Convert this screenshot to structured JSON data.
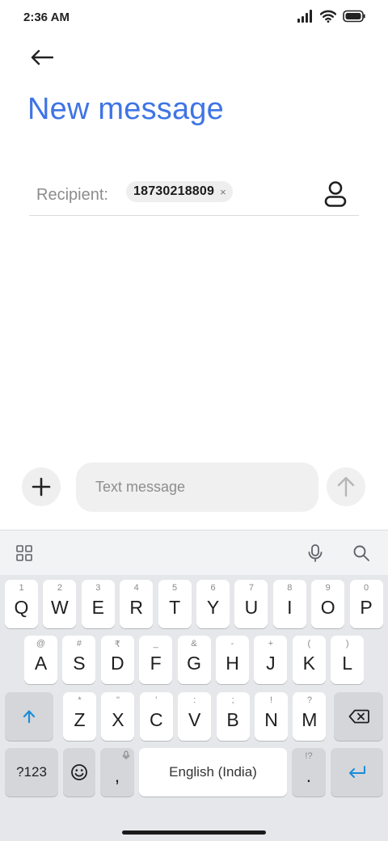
{
  "status_bar": {
    "time": "2:36 AM"
  },
  "header": {
    "title": "New message"
  },
  "recipient": {
    "label": "Recipient:",
    "chip_number": "18730218809",
    "chip_remove": "×"
  },
  "compose": {
    "placeholder": "Text message"
  },
  "keyboard": {
    "row1": [
      {
        "hint": "1",
        "key": "Q"
      },
      {
        "hint": "2",
        "key": "W"
      },
      {
        "hint": "3",
        "key": "E"
      },
      {
        "hint": "4",
        "key": "R"
      },
      {
        "hint": "5",
        "key": "T"
      },
      {
        "hint": "6",
        "key": "Y"
      },
      {
        "hint": "7",
        "key": "U"
      },
      {
        "hint": "8",
        "key": "I"
      },
      {
        "hint": "9",
        "key": "O"
      },
      {
        "hint": "0",
        "key": "P"
      }
    ],
    "row2": [
      {
        "hint": "@",
        "key": "A"
      },
      {
        "hint": "#",
        "key": "S"
      },
      {
        "hint": "₹",
        "key": "D"
      },
      {
        "hint": "_",
        "key": "F"
      },
      {
        "hint": "&",
        "key": "G"
      },
      {
        "hint": "-",
        "key": "H"
      },
      {
        "hint": "+",
        "key": "J"
      },
      {
        "hint": "(",
        "key": "K"
      },
      {
        "hint": ")",
        "key": "L"
      }
    ],
    "row3": [
      {
        "hint": "*",
        "key": "Z"
      },
      {
        "hint": "\"",
        "key": "X"
      },
      {
        "hint": "'",
        "key": "C"
      },
      {
        "hint": ":",
        "key": "V"
      },
      {
        "hint": ";",
        "key": "B"
      },
      {
        "hint": "!",
        "key": "N"
      },
      {
        "hint": "?",
        "key": "M"
      }
    ],
    "symbols_label": "?123",
    "comma": ",",
    "space_label": "English (India)",
    "period": ".",
    "period_hint": "!?",
    "icons": {
      "shift": "shift-icon",
      "backspace": "backspace-icon",
      "emoji": "emoji-icon",
      "enter": "enter-icon",
      "mic": "mic-icon",
      "search": "search-icon",
      "apps": "grid-icon"
    }
  },
  "colors": {
    "accent": "#3f74e6",
    "key_accent": "#1a8cd8"
  }
}
